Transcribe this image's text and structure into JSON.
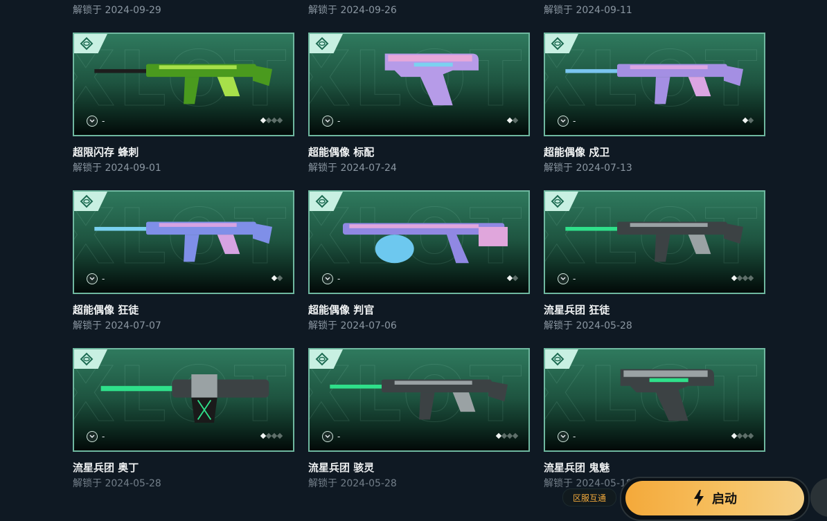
{
  "top_dates": [
    "解锁于 2024-09-29",
    "解锁于 2024-09-26",
    "解锁于 2024-09-11"
  ],
  "cards": [
    {
      "name": "超限闪存 蜂刺",
      "date": "解锁于 2024-09-01",
      "badge_text": "-",
      "levels": 4,
      "level": 1,
      "weapon_icon": "smg-icon",
      "colors": [
        "#4a9a1e",
        "#a7e04a",
        "#1d1d1d"
      ]
    },
    {
      "name": "超能偶像 标配",
      "date": "解锁于 2024-07-24",
      "badge_text": "-",
      "levels": 2,
      "level": 1,
      "weapon_icon": "pistol-icon",
      "colors": [
        "#b69be8",
        "#e7a7d9",
        "#7bd1f0"
      ]
    },
    {
      "name": "超能偶像 戍卫",
      "date": "解锁于 2024-07-13",
      "badge_text": "-",
      "levels": 2,
      "level": 1,
      "weapon_icon": "rifle-icon",
      "colors": [
        "#a48fe3",
        "#dba5e3",
        "#7ac5f0"
      ]
    },
    {
      "name": "超能偶像 狂徒",
      "date": "解锁于 2024-07-07",
      "badge_text": "-",
      "levels": 2,
      "level": 1,
      "weapon_icon": "assault-rifle-icon",
      "colors": [
        "#7f8fe8",
        "#d6a3e2",
        "#7ad1f0"
      ]
    },
    {
      "name": "超能偶像 判官",
      "date": "解锁于 2024-07-06",
      "badge_text": "-",
      "levels": 2,
      "level": 1,
      "weapon_icon": "shotgun-icon",
      "colors": [
        "#9088e3",
        "#e0a6dc",
        "#6dc8ef"
      ]
    },
    {
      "name": "流星兵团 狂徒",
      "date": "解锁于 2024-05-28",
      "badge_text": "-",
      "levels": 4,
      "level": 1,
      "weapon_icon": "assault-rifle-icon",
      "colors": [
        "#3c4244",
        "#9aa2a4",
        "#2fe08a"
      ]
    },
    {
      "name": "流星兵团 奥丁",
      "date": "解锁于 2024-05-28",
      "badge_text": "-",
      "levels": 4,
      "level": 1,
      "weapon_icon": "machine-gun-icon",
      "colors": [
        "#3c4244",
        "#9aa2a4",
        "#2fe08a"
      ]
    },
    {
      "name": "流星兵团 骇灵",
      "date": "解锁于 2024-05-28",
      "badge_text": "-",
      "levels": 4,
      "level": 1,
      "weapon_icon": "smg-icon",
      "colors": [
        "#3c4244",
        "#9aa2a4",
        "#2fe08a"
      ]
    },
    {
      "name": "流星兵团 鬼魅",
      "date": "解锁于 2024-05-18",
      "badge_text": "-",
      "levels": 4,
      "level": 1,
      "weapon_icon": "pistol-icon",
      "colors": [
        "#3c4244",
        "#9aa2a4",
        "#2fe08a"
      ]
    }
  ],
  "watermark": "XLOT",
  "region_button": "区服互通",
  "launch_button": "启动",
  "accent": "#f4a93a"
}
